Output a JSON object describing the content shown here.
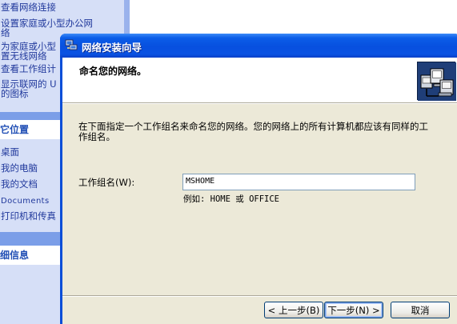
{
  "left_pane": {
    "network_tasks": [
      "查看网络连接",
      "设置家庭或小型办公网",
      "络",
      "为家庭或小型",
      "置无线网络",
      "查看工作组计",
      "显示联网的 U",
      "的图标"
    ],
    "other_places": {
      "heading": "它位置",
      "items": [
        "桌面",
        "我的电脑",
        "我的文档",
        "Documents",
        "打印机和传真"
      ]
    },
    "details": {
      "heading": "细信息"
    }
  },
  "wizard": {
    "title": "网络安装向导",
    "header_title": "命名您的网络。",
    "instruction": "在下面指定一个工作组名来命名您的网络。您的网络上的所有计算机都应该有同样的工作组名。",
    "workgroup_label": "工作组名(W):",
    "workgroup_value": "MSHOME",
    "example": "例如: HOME 或 OFFICE",
    "buttons": {
      "back": "< 上一步(B)",
      "next": "下一步(N) >",
      "cancel": "取消"
    }
  },
  "colors": {
    "titlebar": "#0a52e3",
    "dialog_bg": "#ece9d8",
    "taskpane_bg": "#7b9ee8",
    "taskpane_box": "#d6dff7",
    "link": "#21399c"
  }
}
